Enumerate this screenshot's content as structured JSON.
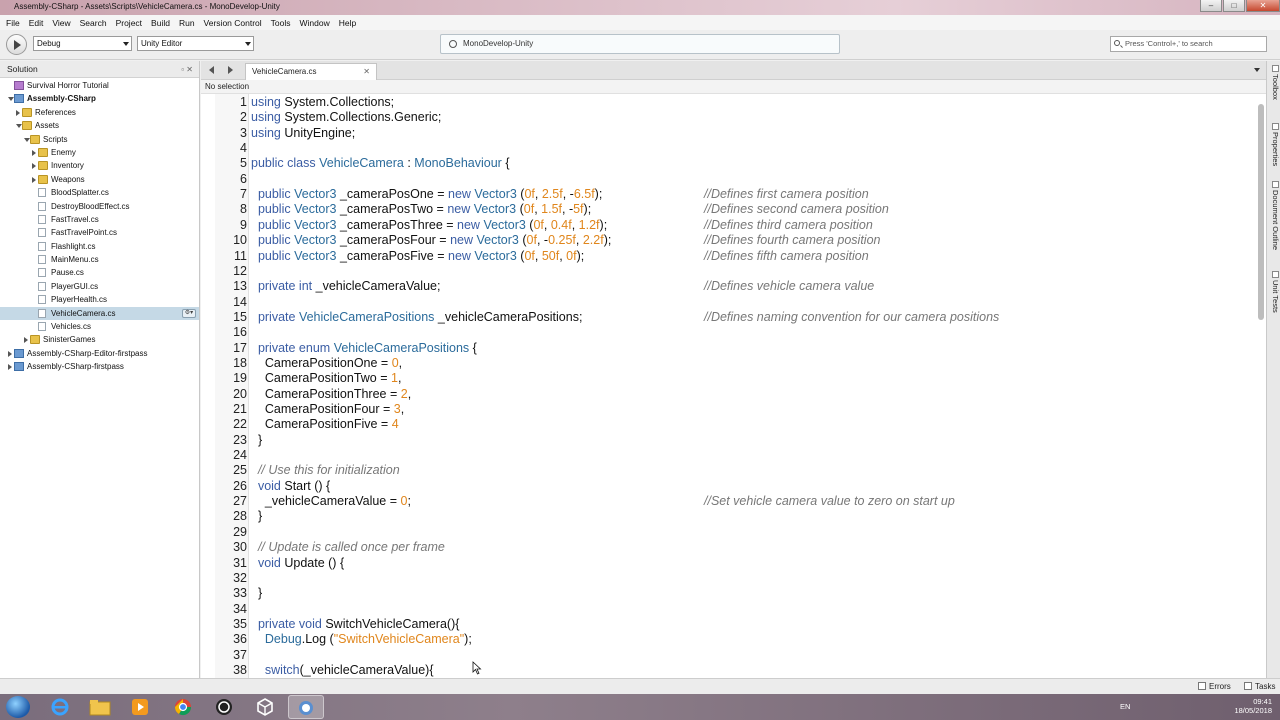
{
  "window": {
    "title": "Assembly-CSharp - Assets\\Scripts\\VehicleCamera.cs - MonoDevelop-Unity"
  },
  "menu": [
    "File",
    "Edit",
    "View",
    "Search",
    "Project",
    "Build",
    "Run",
    "Version Control",
    "Tools",
    "Window",
    "Help"
  ],
  "toolbar": {
    "config": "Debug",
    "target": "Unity Editor",
    "status": "MonoDevelop-Unity",
    "search_placeholder": "Press 'Control+,' to search"
  },
  "solution": {
    "title": "Solution",
    "items": [
      {
        "label": "Survival Horror Tutorial",
        "level": 0,
        "icon": "sol",
        "expander": "none"
      },
      {
        "label": "Assembly-CSharp",
        "level": 0,
        "icon": "proj",
        "expander": "open",
        "bold": true
      },
      {
        "label": "References",
        "level": 1,
        "icon": "folder",
        "expander": "closed"
      },
      {
        "label": "Assets",
        "level": 1,
        "icon": "folder",
        "expander": "open"
      },
      {
        "label": "Scripts",
        "level": 2,
        "icon": "folder",
        "expander": "open"
      },
      {
        "label": "Enemy",
        "level": 3,
        "icon": "folder",
        "expander": "closed"
      },
      {
        "label": "Inventory",
        "level": 3,
        "icon": "folder",
        "expander": "closed"
      },
      {
        "label": "Weapons",
        "level": 3,
        "icon": "folder",
        "expander": "closed"
      },
      {
        "label": "BloodSplatter.cs",
        "level": 3,
        "icon": "file",
        "expander": "none"
      },
      {
        "label": "DestroyBloodEffect.cs",
        "level": 3,
        "icon": "file",
        "expander": "none"
      },
      {
        "label": "FastTravel.cs",
        "level": 3,
        "icon": "file",
        "expander": "none"
      },
      {
        "label": "FastTravelPoint.cs",
        "level": 3,
        "icon": "file",
        "expander": "none"
      },
      {
        "label": "Flashlight.cs",
        "level": 3,
        "icon": "file",
        "expander": "none"
      },
      {
        "label": "MainMenu.cs",
        "level": 3,
        "icon": "file",
        "expander": "none"
      },
      {
        "label": "Pause.cs",
        "level": 3,
        "icon": "file",
        "expander": "none"
      },
      {
        "label": "PlayerGUI.cs",
        "level": 3,
        "icon": "file",
        "expander": "none"
      },
      {
        "label": "PlayerHealth.cs",
        "level": 3,
        "icon": "file",
        "expander": "none"
      },
      {
        "label": "VehicleCamera.cs",
        "level": 3,
        "icon": "file",
        "expander": "none",
        "selected": true
      },
      {
        "label": "Vehicles.cs",
        "level": 3,
        "icon": "file",
        "expander": "none"
      },
      {
        "label": "SinisterGames",
        "level": 2,
        "icon": "folder",
        "expander": "closed"
      },
      {
        "label": "Assembly-CSharp-Editor-firstpass",
        "level": 0,
        "icon": "proj",
        "expander": "closed"
      },
      {
        "label": "Assembly-CSharp-firstpass",
        "level": 0,
        "icon": "proj",
        "expander": "closed"
      }
    ]
  },
  "editor": {
    "tab": "VehicleCamera.cs",
    "path_status": "No selection",
    "lines": [
      {
        "n": "1",
        "segs": [
          [
            "kw",
            "using "
          ],
          [
            "",
            "System.Collections;"
          ]
        ]
      },
      {
        "n": "2",
        "segs": [
          [
            "kw",
            "using "
          ],
          [
            "",
            "System.Collections.Generic;"
          ]
        ]
      },
      {
        "n": "3",
        "segs": [
          [
            "kw",
            "using "
          ],
          [
            "",
            "UnityEngine;"
          ]
        ]
      },
      {
        "n": "4",
        "segs": []
      },
      {
        "n": "5",
        "segs": [
          [
            "kw",
            "public class "
          ],
          [
            "ty",
            "VehicleCamera"
          ],
          [
            "",
            " : "
          ],
          [
            "ty",
            "MonoBehaviour"
          ],
          [
            "",
            " {"
          ]
        ]
      },
      {
        "n": "6",
        "segs": []
      },
      {
        "n": "7",
        "segs": [
          [
            "kw",
            "  public "
          ],
          [
            "ty",
            "Vector3"
          ],
          [
            "",
            " _cameraPosOne = "
          ],
          [
            "kw",
            "new "
          ],
          [
            "ty",
            "Vector3"
          ],
          [
            "",
            " ("
          ],
          [
            "num",
            "0f"
          ],
          [
            "",
            ", "
          ],
          [
            "num",
            "2.5f"
          ],
          [
            "",
            ", -"
          ],
          [
            "num",
            "6.5f"
          ],
          [
            "",
            ");"
          ]
        ],
        "comment": "//Defines first camera position"
      },
      {
        "n": "8",
        "segs": [
          [
            "kw",
            "  public "
          ],
          [
            "ty",
            "Vector3"
          ],
          [
            "",
            " _cameraPosTwo = "
          ],
          [
            "kw",
            "new "
          ],
          [
            "ty",
            "Vector3"
          ],
          [
            "",
            " ("
          ],
          [
            "num",
            "0f"
          ],
          [
            "",
            ", "
          ],
          [
            "num",
            "1.5f"
          ],
          [
            "",
            ", -"
          ],
          [
            "num",
            "5f"
          ],
          [
            "",
            ");"
          ]
        ],
        "comment": "//Defines second camera position"
      },
      {
        "n": "9",
        "segs": [
          [
            "kw",
            "  public "
          ],
          [
            "ty",
            "Vector3"
          ],
          [
            "",
            " _cameraPosThree = "
          ],
          [
            "kw",
            "new "
          ],
          [
            "ty",
            "Vector3"
          ],
          [
            "",
            " ("
          ],
          [
            "num",
            "0f"
          ],
          [
            "",
            ", "
          ],
          [
            "num",
            "0.4f"
          ],
          [
            "",
            ", "
          ],
          [
            "num",
            "1.2f"
          ],
          [
            "",
            ");"
          ]
        ],
        "comment": "//Defines third camera position"
      },
      {
        "n": "10",
        "segs": [
          [
            "kw",
            "  public "
          ],
          [
            "ty",
            "Vector3"
          ],
          [
            "",
            " _cameraPosFour = "
          ],
          [
            "kw",
            "new "
          ],
          [
            "ty",
            "Vector3"
          ],
          [
            "",
            " ("
          ],
          [
            "num",
            "0f"
          ],
          [
            "",
            ", -"
          ],
          [
            "num",
            "0.25f"
          ],
          [
            "",
            ", "
          ],
          [
            "num",
            "2.2f"
          ],
          [
            "",
            ");"
          ]
        ],
        "comment": "//Defines fourth camera position"
      },
      {
        "n": "11",
        "segs": [
          [
            "kw",
            "  public "
          ],
          [
            "ty",
            "Vector3"
          ],
          [
            "",
            " _cameraPosFive = "
          ],
          [
            "kw",
            "new "
          ],
          [
            "ty",
            "Vector3"
          ],
          [
            "",
            " ("
          ],
          [
            "num",
            "0f"
          ],
          [
            "",
            ", "
          ],
          [
            "num",
            "50f"
          ],
          [
            "",
            ", "
          ],
          [
            "num",
            "0f"
          ],
          [
            "",
            ");"
          ]
        ],
        "comment": "//Defines fifth camera position"
      },
      {
        "n": "12",
        "segs": []
      },
      {
        "n": "13",
        "segs": [
          [
            "kw",
            "  private int "
          ],
          [
            "",
            "_vehicleCameraValue;"
          ]
        ],
        "comment": "//Defines vehicle camera value"
      },
      {
        "n": "14",
        "segs": []
      },
      {
        "n": "15",
        "segs": [
          [
            "kw",
            "  private "
          ],
          [
            "ty",
            "VehicleCameraPositions"
          ],
          [
            "",
            " _vehicleCameraPositions;"
          ]
        ],
        "comment": "//Defines naming convention for our camera positions"
      },
      {
        "n": "16",
        "segs": []
      },
      {
        "n": "17",
        "segs": [
          [
            "kw",
            "  private enum "
          ],
          [
            "ty",
            "VehicleCameraPositions"
          ],
          [
            "",
            " {"
          ]
        ]
      },
      {
        "n": "18",
        "segs": [
          [
            "",
            "    CameraPositionOne = "
          ],
          [
            "num",
            "0"
          ],
          [
            "",
            ","
          ]
        ]
      },
      {
        "n": "19",
        "segs": [
          [
            "",
            "    CameraPositionTwo = "
          ],
          [
            "num",
            "1"
          ],
          [
            "",
            ","
          ]
        ]
      },
      {
        "n": "20",
        "segs": [
          [
            "",
            "    CameraPositionThree = "
          ],
          [
            "num",
            "2"
          ],
          [
            "",
            ","
          ]
        ]
      },
      {
        "n": "21",
        "segs": [
          [
            "",
            "    CameraPositionFour = "
          ],
          [
            "num",
            "3"
          ],
          [
            "",
            ","
          ]
        ]
      },
      {
        "n": "22",
        "segs": [
          [
            "",
            "    CameraPositionFive = "
          ],
          [
            "num",
            "4"
          ]
        ]
      },
      {
        "n": "23",
        "segs": [
          [
            "",
            "  }"
          ]
        ]
      },
      {
        "n": "24",
        "segs": []
      },
      {
        "n": "25",
        "segs": [
          [
            "cmt",
            "  // Use this for initialization"
          ]
        ]
      },
      {
        "n": "26",
        "segs": [
          [
            "kw",
            "  void "
          ],
          [
            "",
            "Start () {"
          ]
        ]
      },
      {
        "n": "27",
        "segs": [
          [
            "",
            "    _vehicleCameraValue = "
          ],
          [
            "num",
            "0"
          ],
          [
            "",
            ";"
          ]
        ],
        "comment": "//Set vehicle camera value to zero on start up"
      },
      {
        "n": "28",
        "segs": [
          [
            "",
            "  }"
          ]
        ]
      },
      {
        "n": "29",
        "segs": []
      },
      {
        "n": "30",
        "segs": [
          [
            "cmt",
            "  // Update is called once per frame"
          ]
        ]
      },
      {
        "n": "31",
        "segs": [
          [
            "kw",
            "  void "
          ],
          [
            "",
            "Update () {"
          ]
        ]
      },
      {
        "n": "32",
        "segs": []
      },
      {
        "n": "33",
        "segs": [
          [
            "",
            "  }"
          ]
        ]
      },
      {
        "n": "34",
        "segs": []
      },
      {
        "n": "35",
        "segs": [
          [
            "kw",
            "  private void "
          ],
          [
            "",
            "SwitchVehicleCamera(){"
          ]
        ]
      },
      {
        "n": "36",
        "segs": [
          [
            "ty",
            "    Debug"
          ],
          [
            "",
            ".Log ("
          ],
          [
            "str",
            "\"SwitchVehicleCamera\""
          ],
          [
            "",
            ");"
          ]
        ]
      },
      {
        "n": "37",
        "segs": []
      },
      {
        "n": "38",
        "segs": [
          [
            "kw",
            "    switch"
          ],
          [
            "",
            "(_vehicleCameraValue){"
          ]
        ]
      }
    ]
  },
  "right_dock": [
    "Toolbox",
    "Properties",
    "Document Outline",
    "Unit Tests"
  ],
  "statusbar": {
    "errors": "Errors",
    "tasks": "Tasks"
  },
  "taskbar": {
    "lang": "EN",
    "time": "09:41",
    "date": "18/05/2018"
  }
}
